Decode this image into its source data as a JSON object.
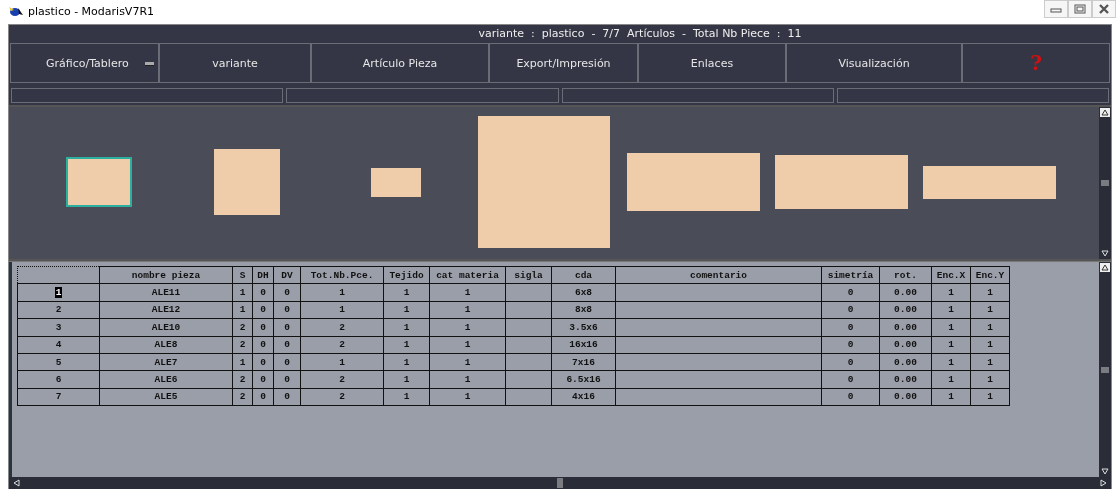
{
  "window": {
    "title": "plastico - ModarisV7R1"
  },
  "header": {
    "text": "variante  :  plastico  -  7/7  Artículos  -  Total Nb Piece  :  11"
  },
  "toolbar": [
    {
      "label": "Gráfico/Tablero",
      "kind": "dropdown"
    },
    {
      "label": "variante",
      "kind": "button"
    },
    {
      "label": "Artículo Pieza",
      "kind": "button"
    },
    {
      "label": "Export/Impresión",
      "kind": "button"
    },
    {
      "label": "Enlaces",
      "kind": "button"
    },
    {
      "label": "Visualización",
      "kind": "button"
    },
    {
      "label": "?",
      "kind": "help"
    }
  ],
  "table": {
    "columns": [
      "",
      "nombre pieza",
      "S",
      "DH",
      "DV",
      "Tot.Nb.Pce.",
      "Tejido",
      "cat materia",
      "sigla",
      "cda",
      "comentario",
      "simetría",
      "rot.",
      "Enc.X",
      "Enc.Y"
    ],
    "rows": [
      {
        "selected": true,
        "cells": [
          "1",
          "ALE11",
          "1",
          "0",
          "0",
          "1",
          "1",
          "1",
          "",
          "6x8",
          "",
          "0",
          "0.00",
          "1",
          "1"
        ]
      },
      {
        "selected": false,
        "cells": [
          "2",
          "ALE12",
          "1",
          "0",
          "0",
          "1",
          "1",
          "1",
          "",
          "8x8",
          "",
          "0",
          "0.00",
          "1",
          "1"
        ]
      },
      {
        "selected": false,
        "cells": [
          "3",
          "ALE10",
          "2",
          "0",
          "0",
          "2",
          "1",
          "1",
          "",
          "3.5x6",
          "",
          "0",
          "0.00",
          "1",
          "1"
        ]
      },
      {
        "selected": false,
        "cells": [
          "4",
          "ALE8",
          "2",
          "0",
          "0",
          "2",
          "1",
          "1",
          "",
          "16x16",
          "",
          "0",
          "0.00",
          "1",
          "1"
        ]
      },
      {
        "selected": false,
        "cells": [
          "5",
          "ALE7",
          "1",
          "0",
          "0",
          "1",
          "1",
          "1",
          "",
          "7x16",
          "",
          "0",
          "0.00",
          "1",
          "1"
        ]
      },
      {
        "selected": false,
        "cells": [
          "6",
          "ALE6",
          "2",
          "0",
          "0",
          "2",
          "1",
          "1",
          "",
          "6.5x16",
          "",
          "0",
          "0.00",
          "1",
          "1"
        ]
      },
      {
        "selected": false,
        "cells": [
          "7",
          "ALE5",
          "2",
          "0",
          "0",
          "2",
          "1",
          "1",
          "",
          "4x16",
          "",
          "0",
          "0.00",
          "1",
          "1"
        ]
      }
    ]
  }
}
